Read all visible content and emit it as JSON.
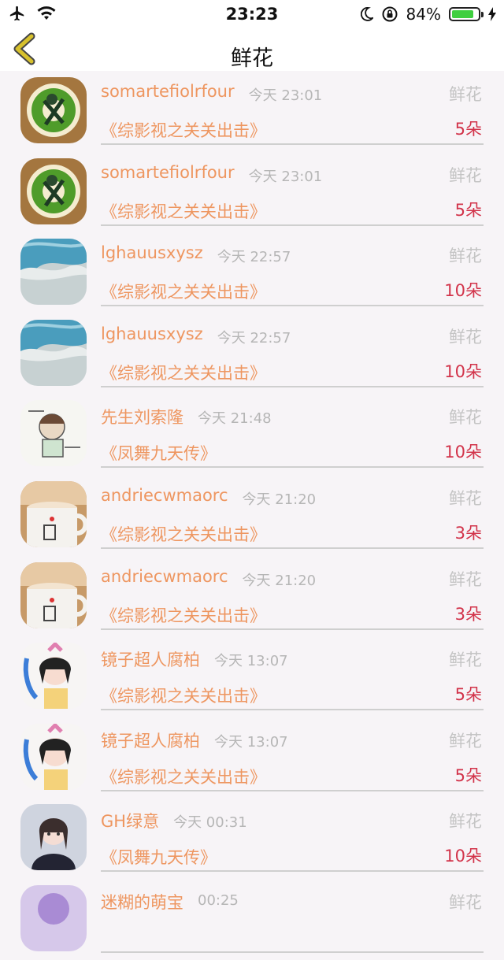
{
  "status_bar": {
    "time": "23:23",
    "battery_percent": "84%",
    "battery_level": 0.84,
    "battery_color": "#3fcf3f",
    "icons": [
      "airplane-icon",
      "wifi-icon",
      "moon-icon",
      "rotation-lock-icon",
      "charging-icon"
    ]
  },
  "nav": {
    "title": "鲜花",
    "back_icon": "chevron-left-icon",
    "back_color": "#d7c12d"
  },
  "colors": {
    "name": "#ee9660",
    "time": "#b6b6b6",
    "gift": "#c4c4c4",
    "count": "#d2334a",
    "divider": "#cfcfcf"
  },
  "rows": [
    {
      "avatar": "avatar-green-warrior",
      "name": "somartefiolrfour",
      "time": "今天 23:01",
      "gift": "鲜花",
      "title": "《综影视之关关出击》",
      "count": "5朵"
    },
    {
      "avatar": "avatar-green-warrior",
      "name": "somartefiolrfour",
      "time": "今天 23:01",
      "gift": "鲜花",
      "title": "《综影视之关关出击》",
      "count": "5朵"
    },
    {
      "avatar": "avatar-beach",
      "name": "lghauusxysz",
      "time": "今天 22:57",
      "gift": "鲜花",
      "title": "《综影视之关关出击》",
      "count": "10朵"
    },
    {
      "avatar": "avatar-beach",
      "name": "lghauusxysz",
      "time": "今天 22:57",
      "gift": "鲜花",
      "title": "《综影视之关关出击》",
      "count": "10朵"
    },
    {
      "avatar": "avatar-sketch",
      "name": "先生刘索隆",
      "time": "今天 21:48",
      "gift": "鲜花",
      "title": "《凤舞九天传》",
      "count": "10朵"
    },
    {
      "avatar": "avatar-mug",
      "name": "andriecwmaorc",
      "time": "今天 21:20",
      "gift": "鲜花",
      "title": "《综影视之关关出击》",
      "count": "3朵"
    },
    {
      "avatar": "avatar-mug",
      "name": "andriecwmaorc",
      "time": "今天 21:20",
      "gift": "鲜花",
      "title": "《综影视之关关出击》",
      "count": "3朵"
    },
    {
      "avatar": "avatar-anime-girl",
      "name": "镜子超人腐柏",
      "time": "今天 13:07",
      "gift": "鲜花",
      "title": "《综影视之关关出击》",
      "count": "5朵"
    },
    {
      "avatar": "avatar-anime-girl",
      "name": "镜子超人腐柏",
      "time": "今天 13:07",
      "gift": "鲜花",
      "title": "《综影视之关关出击》",
      "count": "5朵"
    },
    {
      "avatar": "avatar-dark-girl",
      "name": "GH绿意",
      "time": "今天 00:31",
      "gift": "鲜花",
      "title": "《凤舞九天传》",
      "count": "10朵"
    },
    {
      "avatar": "avatar-purple",
      "name": "迷糊的萌宝",
      "time": "00:25",
      "gift": "鲜花",
      "title": "",
      "count": ""
    }
  ]
}
